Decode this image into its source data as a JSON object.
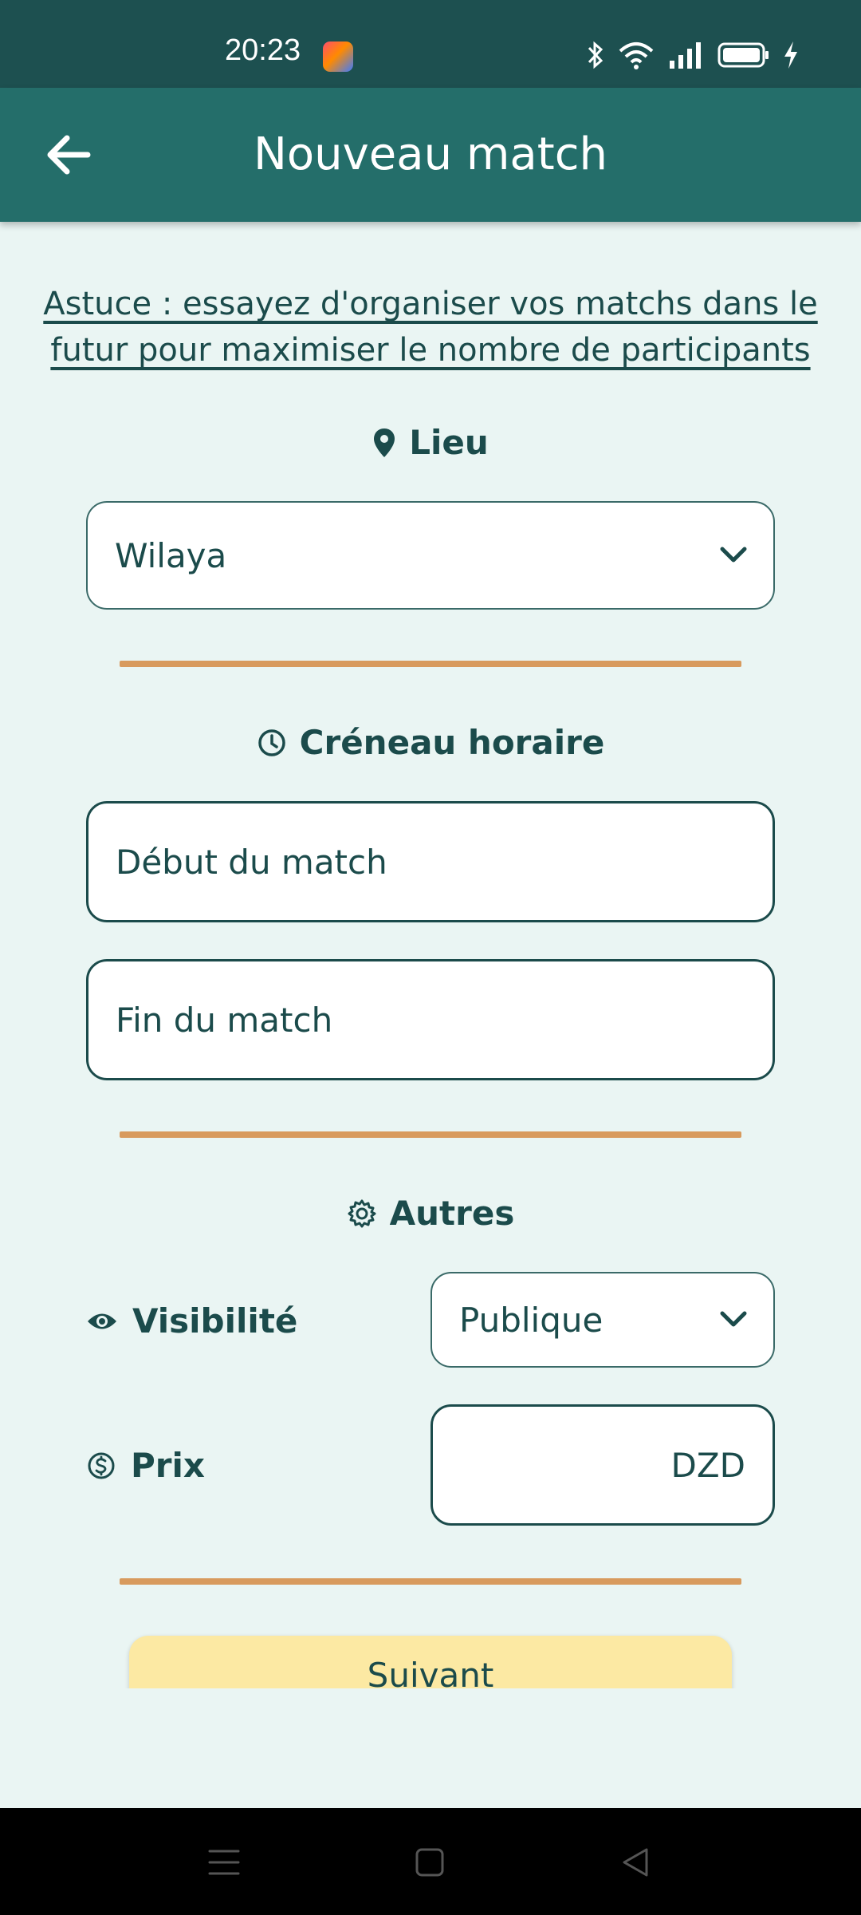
{
  "status_bar": {
    "time": "20:23",
    "icons": [
      "app-notification-icon",
      "bluetooth-icon",
      "wifi-icon",
      "signal-icon",
      "battery-icon",
      "charging-icon"
    ]
  },
  "app_bar": {
    "title": "Nouveau match",
    "back_icon": "arrow-left-icon"
  },
  "tip": "Astuce : essayez d'organiser vos matchs dans le futur pour maximiser le nombre de participants",
  "location": {
    "title": "Lieu",
    "icon": "map-pin-icon",
    "wilaya_select": {
      "value": "Wilaya"
    }
  },
  "time_slot": {
    "title": "Créneau horaire",
    "icon": "clock-icon",
    "start_placeholder": "Début du match",
    "end_placeholder": "Fin du match"
  },
  "others": {
    "title": "Autres",
    "icon": "gear-icon",
    "visibility": {
      "label": "Visibilité",
      "icon": "eye-icon",
      "value": "Publique"
    },
    "price": {
      "label": "Prix",
      "icon": "dollar-icon",
      "currency": "DZD"
    }
  },
  "next_button": {
    "label": "Suivant"
  },
  "nav_bar": {
    "icons": [
      "menu-icon",
      "home-icon",
      "back-icon"
    ]
  },
  "colors": {
    "status_bar": "#1d5050",
    "app_bar": "#246e6a",
    "background": "#eaf5f3",
    "text": "#1b4b4b",
    "divider": "#d89a5d",
    "next_button": "#fce9a3"
  }
}
